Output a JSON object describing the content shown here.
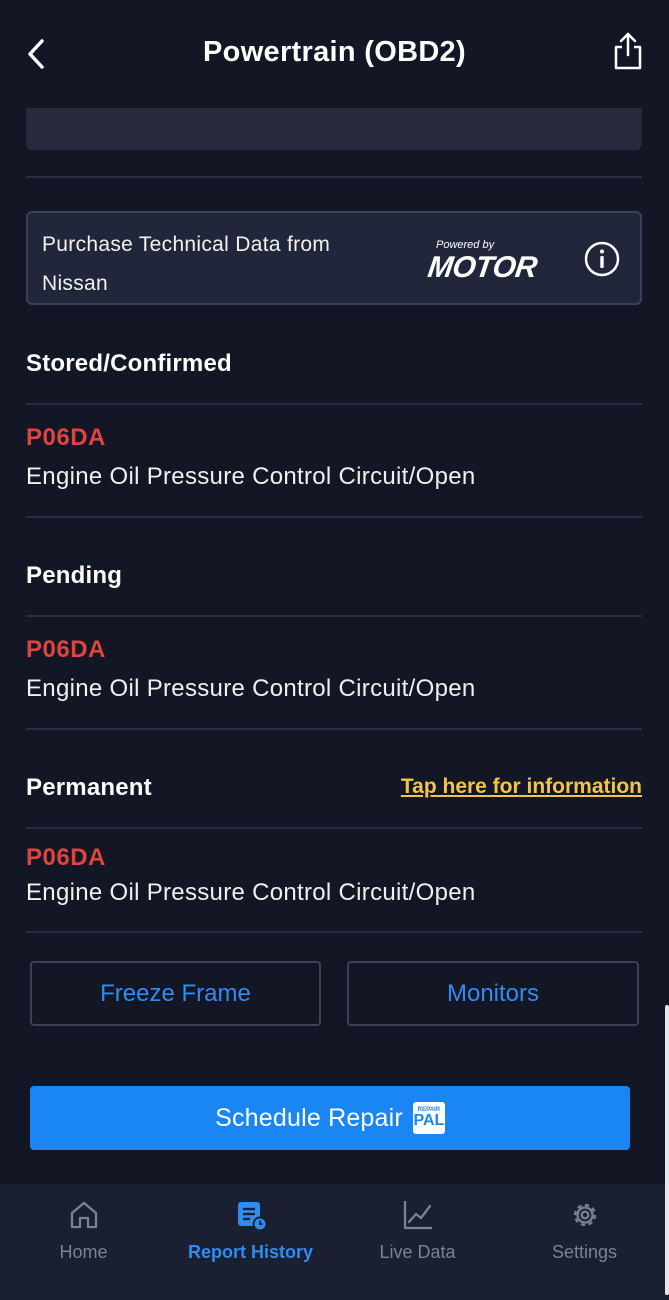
{
  "header": {
    "title": "Powertrain (OBD2)",
    "back_icon": "chevron-left-icon",
    "share_icon": "share-icon"
  },
  "motor_banner": {
    "text": "Purchase Technical Data from Nissan",
    "powered_by": "Powered by",
    "brand": "MOTOR",
    "info_icon": "info-icon"
  },
  "sections": {
    "stored": {
      "title": "Stored/Confirmed",
      "code": "P06DA",
      "description": "Engine Oil Pressure Control Circuit/Open"
    },
    "pending": {
      "title": "Pending",
      "code": "P06DA",
      "description": "Engine Oil Pressure Control Circuit/Open"
    },
    "permanent": {
      "title": "Permanent",
      "info_link": "Tap here for information",
      "code": "P06DA",
      "description": "Engine Oil Pressure Control Circuit/Open"
    }
  },
  "actions": {
    "freeze_frame": "Freeze Frame",
    "monitors": "Monitors",
    "schedule_repair": "Schedule Repair",
    "repairpal_top": "REPAIR",
    "repairpal_bottom": "PAL"
  },
  "tabbar": {
    "items": [
      {
        "label": "Home",
        "icon": "home-icon",
        "active": false
      },
      {
        "label": "Report History",
        "icon": "report-history-icon",
        "active": true
      },
      {
        "label": "Live Data",
        "icon": "chart-icon",
        "active": false
      },
      {
        "label": "Settings",
        "icon": "gear-icon",
        "active": false
      }
    ]
  },
  "colors": {
    "background": "#131625",
    "accent": "#1a86f4",
    "code_red": "#e0443f",
    "link_yellow": "#f3c445"
  }
}
